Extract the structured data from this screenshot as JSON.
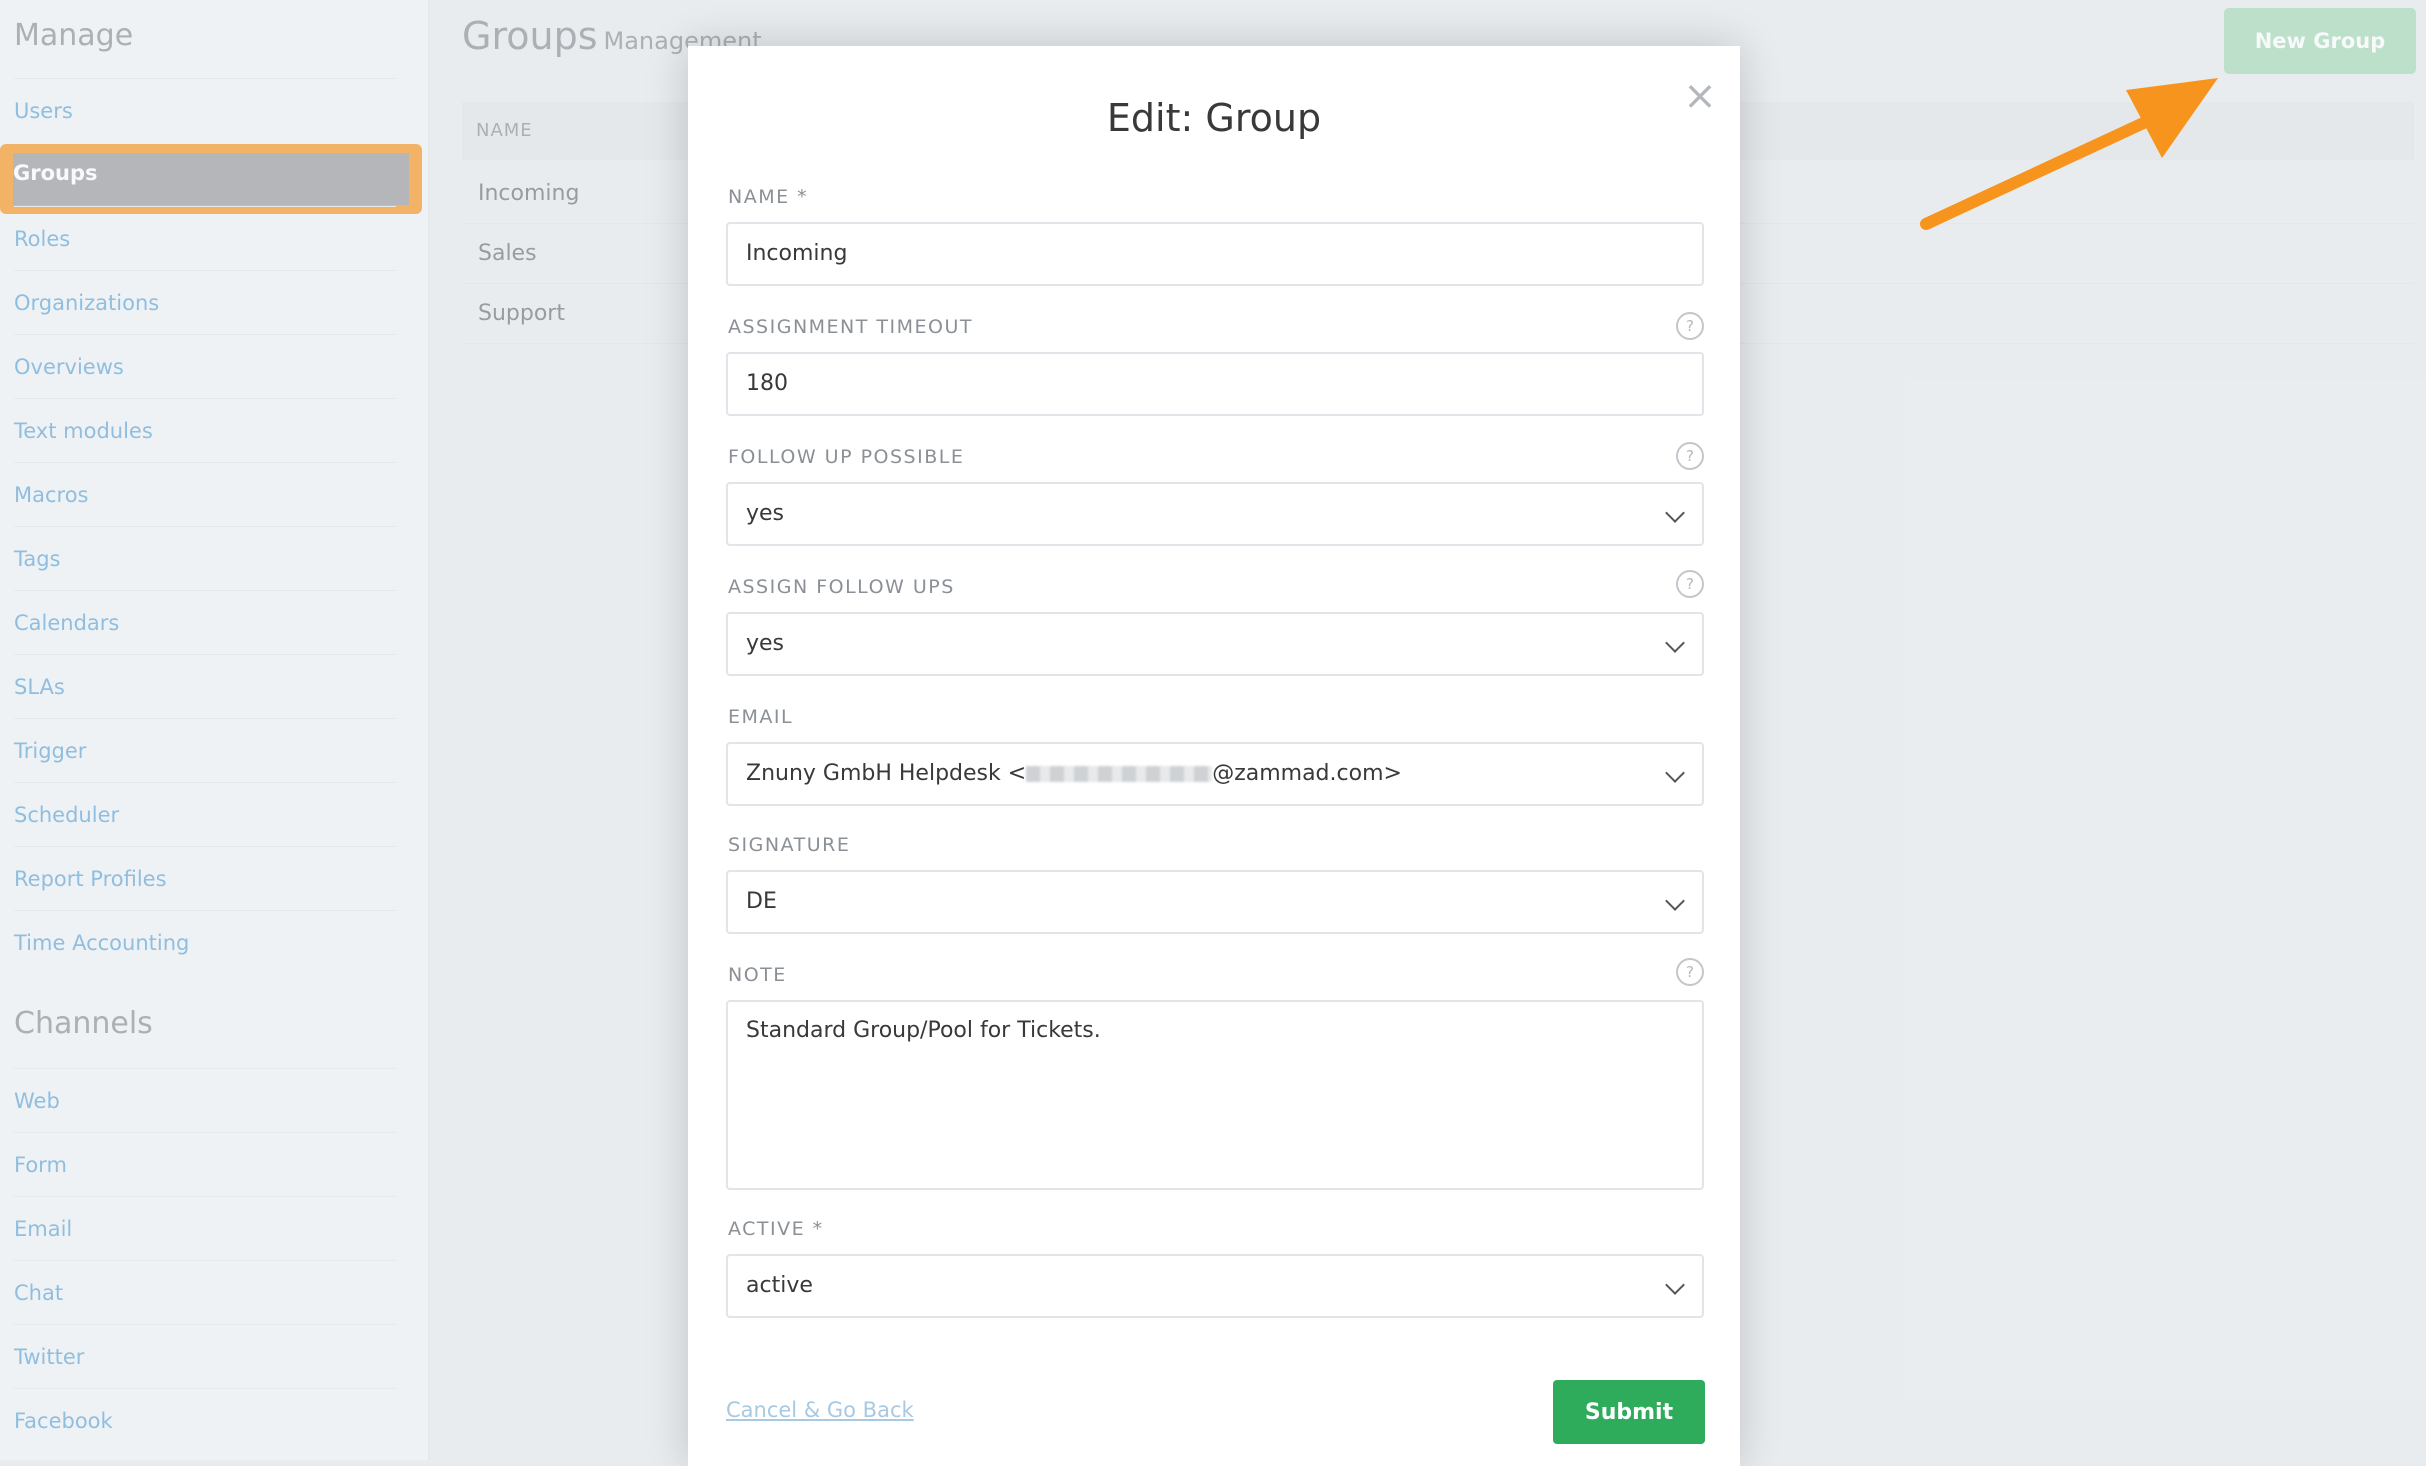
{
  "sidebar": {
    "manage_heading": "Manage",
    "manage_items": [
      {
        "label": "Users"
      },
      {
        "label": "Groups"
      },
      {
        "label": "Roles"
      },
      {
        "label": "Organizations"
      },
      {
        "label": "Overviews"
      },
      {
        "label": "Text modules"
      },
      {
        "label": "Macros"
      },
      {
        "label": "Tags"
      },
      {
        "label": "Calendars"
      },
      {
        "label": "SLAs"
      },
      {
        "label": "Trigger"
      },
      {
        "label": "Scheduler"
      },
      {
        "label": "Report Profiles"
      },
      {
        "label": "Time Accounting"
      }
    ],
    "active_item": "Groups",
    "channels_heading": "Channels",
    "channel_items": [
      {
        "label": "Web"
      },
      {
        "label": "Form"
      },
      {
        "label": "Email"
      },
      {
        "label": "Chat"
      },
      {
        "label": "Twitter"
      },
      {
        "label": "Facebook"
      }
    ]
  },
  "content": {
    "title": "Groups",
    "subtitle": "Management",
    "new_button": "New Group",
    "table_header": "NAME",
    "rows": [
      "Incoming",
      "Sales",
      "Support"
    ]
  },
  "modal": {
    "title": "Edit: Group",
    "fields": {
      "name": {
        "label": "NAME *",
        "value": "Incoming"
      },
      "assignment_timeout": {
        "label": "ASSIGNMENT TIMEOUT",
        "value": "180"
      },
      "follow_up_possible": {
        "label": "FOLLOW UP POSSIBLE",
        "value": "yes"
      },
      "assign_follow_ups": {
        "label": "ASSIGN FOLLOW UPS",
        "value": "yes"
      },
      "email": {
        "label": "EMAIL",
        "value_prefix": "Znuny GmbH Helpdesk <",
        "value_suffix": "@zammad.com>"
      },
      "signature": {
        "label": "SIGNATURE",
        "value": "DE"
      },
      "note": {
        "label": "NOTE",
        "value": "Standard Group/Pool for Tickets."
      },
      "active": {
        "label": "ACTIVE *",
        "value": "active"
      }
    },
    "help_glyph": "?",
    "close_glyph": "×",
    "cancel_label": "Cancel & Go Back",
    "submit_label": "Submit"
  },
  "colors": {
    "highlight": "#f7941d",
    "link": "#5ea5d8",
    "submit": "#2eab5b",
    "new_group_button": "#a3d9b4"
  }
}
